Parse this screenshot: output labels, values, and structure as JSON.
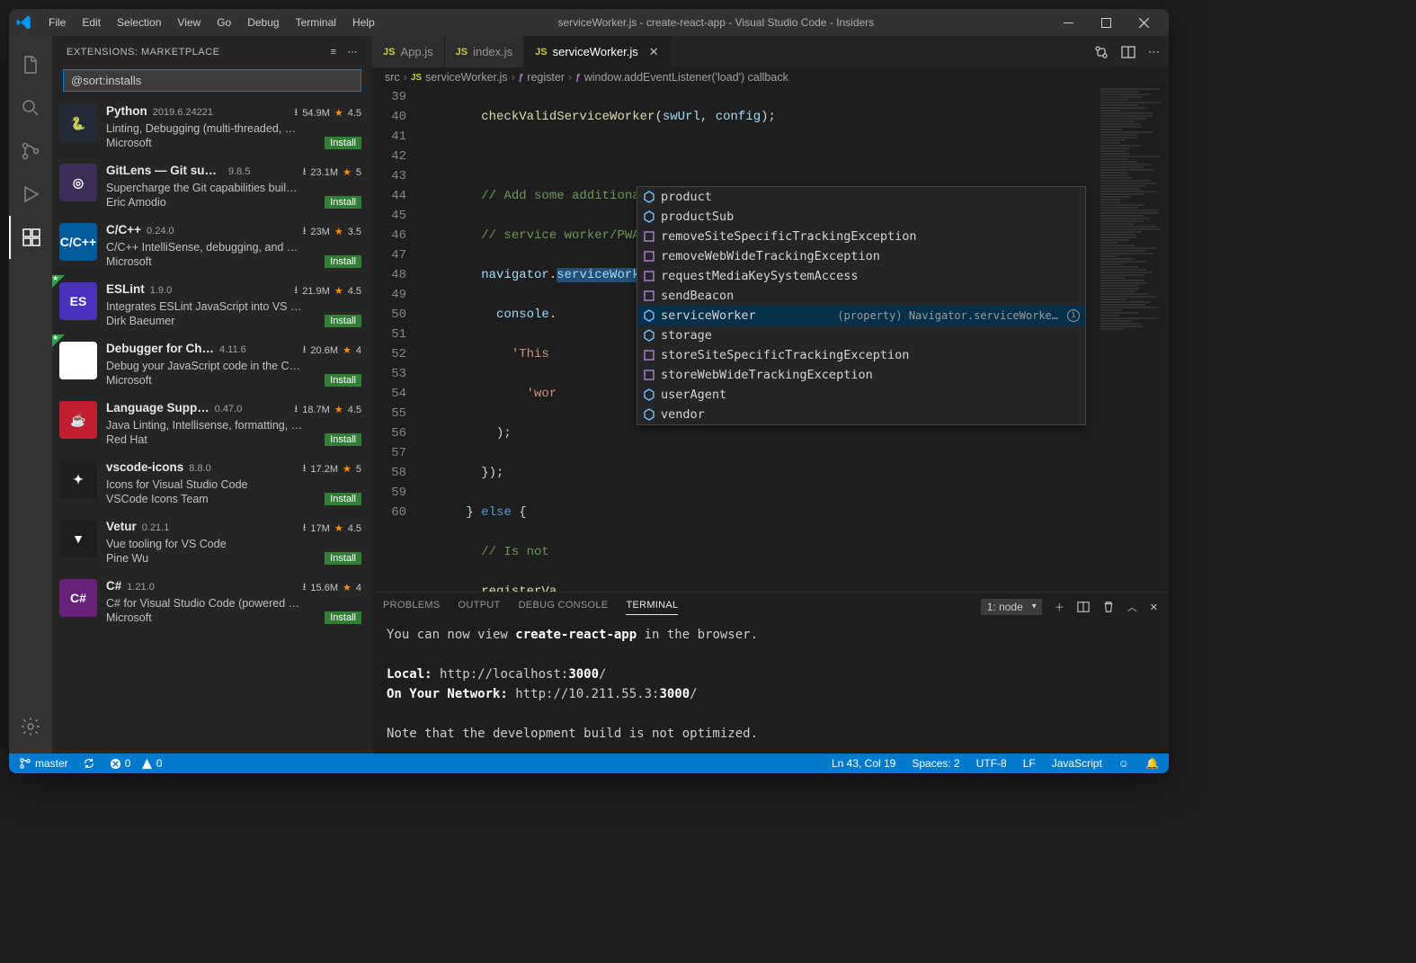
{
  "title": "serviceWorker.js - create-react-app - Visual Studio Code - Insiders",
  "menu": [
    "File",
    "Edit",
    "Selection",
    "View",
    "Go",
    "Debug",
    "Terminal",
    "Help"
  ],
  "sidebar": {
    "title": "EXTENSIONS: MARKETPLACE",
    "search": "@sort:installs"
  },
  "extensions": [
    {
      "name": "Python",
      "version": "2019.6.24221",
      "downloads": "54.9M",
      "rating": "4.5",
      "desc": "Linting, Debugging (multi-threaded, …",
      "publisher": "Microsoft",
      "install": "Install",
      "iconBg": "#242938",
      "iconText": "🐍",
      "featured": false
    },
    {
      "name": "GitLens — Git sup…",
      "version": "9.8.5",
      "downloads": "23.1M",
      "rating": "5",
      "desc": "Supercharge the Git capabilities buil…",
      "publisher": "Eric Amodio",
      "install": "Install",
      "iconBg": "#3b2e58",
      "iconText": "◎",
      "featured": false
    },
    {
      "name": "C/C++",
      "version": "0.24.0",
      "downloads": "23M",
      "rating": "3.5",
      "desc": "C/C++ IntelliSense, debugging, and …",
      "publisher": "Microsoft",
      "install": "Install",
      "iconBg": "#005a9c",
      "iconText": "C/C++",
      "featured": false
    },
    {
      "name": "ESLint",
      "version": "1.9.0",
      "downloads": "21.9M",
      "rating": "4.5",
      "desc": "Integrates ESLint JavaScript into VS …",
      "publisher": "Dirk Baeumer",
      "install": "Install",
      "iconBg": "#4930bd",
      "iconText": "ES",
      "featured": true
    },
    {
      "name": "Debugger for Ch…",
      "version": "4.11.6",
      "downloads": "20.6M",
      "rating": "4",
      "desc": "Debug your JavaScript code in the C…",
      "publisher": "Microsoft",
      "install": "Install",
      "iconBg": "#fff",
      "iconText": "◐",
      "featured": true
    },
    {
      "name": "Language Supp…",
      "version": "0.47.0",
      "downloads": "18.7M",
      "rating": "4.5",
      "desc": "Java Linting, Intellisense, formatting, …",
      "publisher": "Red Hat",
      "install": "Install",
      "iconBg": "#c11e2f",
      "iconText": "☕",
      "featured": false
    },
    {
      "name": "vscode-icons",
      "version": "8.8.0",
      "downloads": "17.2M",
      "rating": "5",
      "desc": "Icons for Visual Studio Code",
      "publisher": "VSCode Icons Team",
      "install": "Install",
      "iconBg": "#1e1e1e",
      "iconText": "✦",
      "featured": false
    },
    {
      "name": "Vetur",
      "version": "0.21.1",
      "downloads": "17M",
      "rating": "4.5",
      "desc": "Vue tooling for VS Code",
      "publisher": "Pine Wu",
      "install": "Install",
      "iconBg": "#1e1e1e",
      "iconText": "▼",
      "featured": false
    },
    {
      "name": "C#",
      "version": "1.21.0",
      "downloads": "15.6M",
      "rating": "4",
      "desc": "C# for Visual Studio Code (powered …",
      "publisher": "Microsoft",
      "install": "Install",
      "iconBg": "#68217a",
      "iconText": "C#",
      "featured": false
    }
  ],
  "tabs": [
    {
      "label": "App.js",
      "active": false
    },
    {
      "label": "index.js",
      "active": false
    },
    {
      "label": "serviceWorker.js",
      "active": true
    }
  ],
  "breadcrumb": {
    "folder": "src",
    "file": "serviceWorker.js",
    "fn1": "register",
    "fn2": "window.addEventListener('load') callback"
  },
  "lineStart": 39,
  "lineEnd": 60,
  "suggest": {
    "items": [
      {
        "label": "product",
        "kind": "field"
      },
      {
        "label": "productSub",
        "kind": "field"
      },
      {
        "label": "removeSiteSpecificTrackingException",
        "kind": "method"
      },
      {
        "label": "removeWebWideTrackingException",
        "kind": "method"
      },
      {
        "label": "requestMediaKeySystemAccess",
        "kind": "method"
      },
      {
        "label": "sendBeacon",
        "kind": "method"
      },
      {
        "label": "serviceWorker",
        "kind": "field",
        "sel": true,
        "detail": "(property) Navigator.serviceWorke…"
      },
      {
        "label": "storage",
        "kind": "field"
      },
      {
        "label": "storeSiteSpecificTrackingException",
        "kind": "method"
      },
      {
        "label": "storeWebWideTrackingException",
        "kind": "method"
      },
      {
        "label": "userAgent",
        "kind": "field"
      },
      {
        "label": "vendor",
        "kind": "field"
      }
    ]
  },
  "panel": {
    "tabs": [
      "PROBLEMS",
      "OUTPUT",
      "DEBUG CONSOLE",
      "TERMINAL"
    ],
    "active": "TERMINAL",
    "terminalSelect": "1: node",
    "terminal": {
      "line1a": "You can now view ",
      "line1b": "create-react-app",
      "line1c": " in the browser.",
      "localLabel": "Local:",
      "localUrl": "http://localhost:",
      "localPort": "3000",
      "localSlash": "/",
      "netLabel": "On Your Network:",
      "netUrl": "http://10.211.55.3:",
      "netPort": "3000",
      "netSlash": "/",
      "note": "Note that the development build is not optimized."
    }
  },
  "status": {
    "branch": "master",
    "errors": "0",
    "warnings": "0",
    "lncol": "Ln 43, Col 19",
    "spaces": "Spaces: 2",
    "enc": "UTF-8",
    "eol": "LF",
    "lang": "JavaScript"
  }
}
